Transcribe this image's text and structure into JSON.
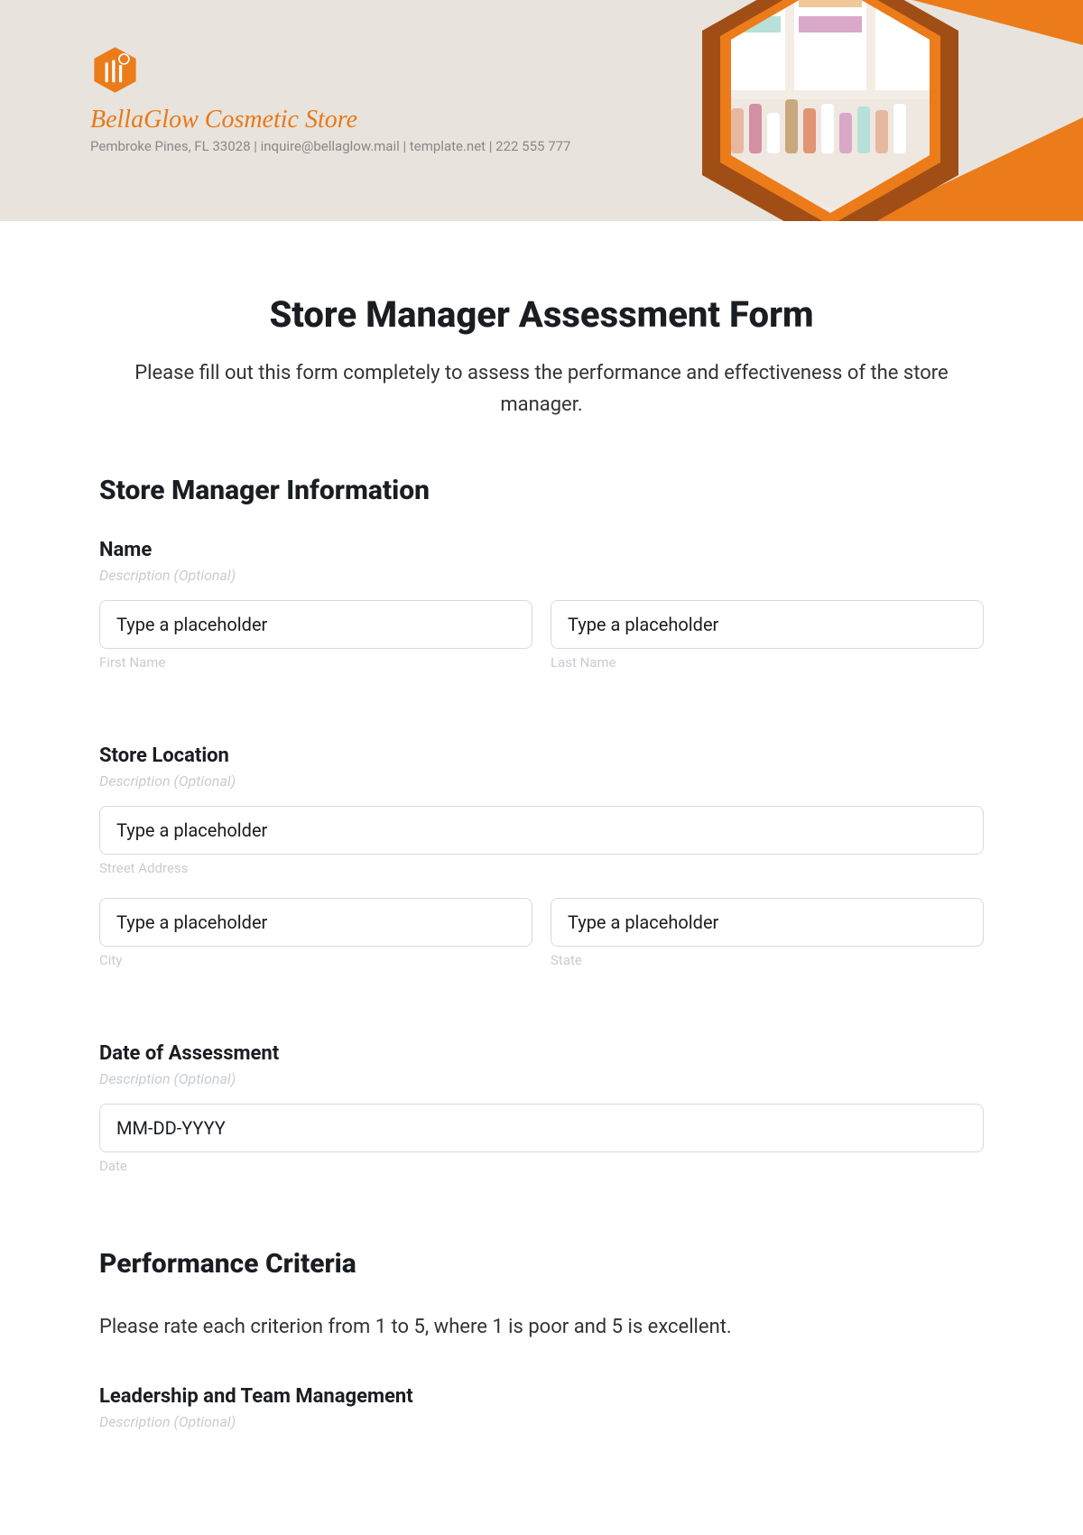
{
  "header": {
    "brand_name": "BellaGlow Cosmetic Store",
    "brand_sub": "Pembroke Pines, FL 33028 | inquire@bellaglow.mail | template.net | 222 555 777"
  },
  "form": {
    "title": "Store Manager Assessment Form",
    "intro": "Please fill out this form completely to assess the performance and effectiveness of the store manager.",
    "section1_heading": "Store Manager Information",
    "name": {
      "label": "Name",
      "desc": "Description (Optional)",
      "first_ph": "Type a placeholder",
      "first_sub": "First Name",
      "last_ph": "Type a placeholder",
      "last_sub": "Last Name"
    },
    "location": {
      "label": "Store Location",
      "desc": "Description (Optional)",
      "street_ph": "Type a placeholder",
      "street_sub": "Street Address",
      "city_ph": "Type a placeholder",
      "city_sub": "City",
      "state_ph": "Type a placeholder",
      "state_sub": "State"
    },
    "date": {
      "label": "Date of Assessment",
      "desc": "Description (Optional)",
      "ph": "MM-DD-YYYY",
      "sub": "Date"
    },
    "section2_heading": "Performance Criteria",
    "section2_intro": "Please rate each criterion from 1 to 5, where 1 is poor and 5 is excellent.",
    "crit1": {
      "label": "Leadership and Team Management",
      "desc": "Description (Optional)"
    }
  }
}
